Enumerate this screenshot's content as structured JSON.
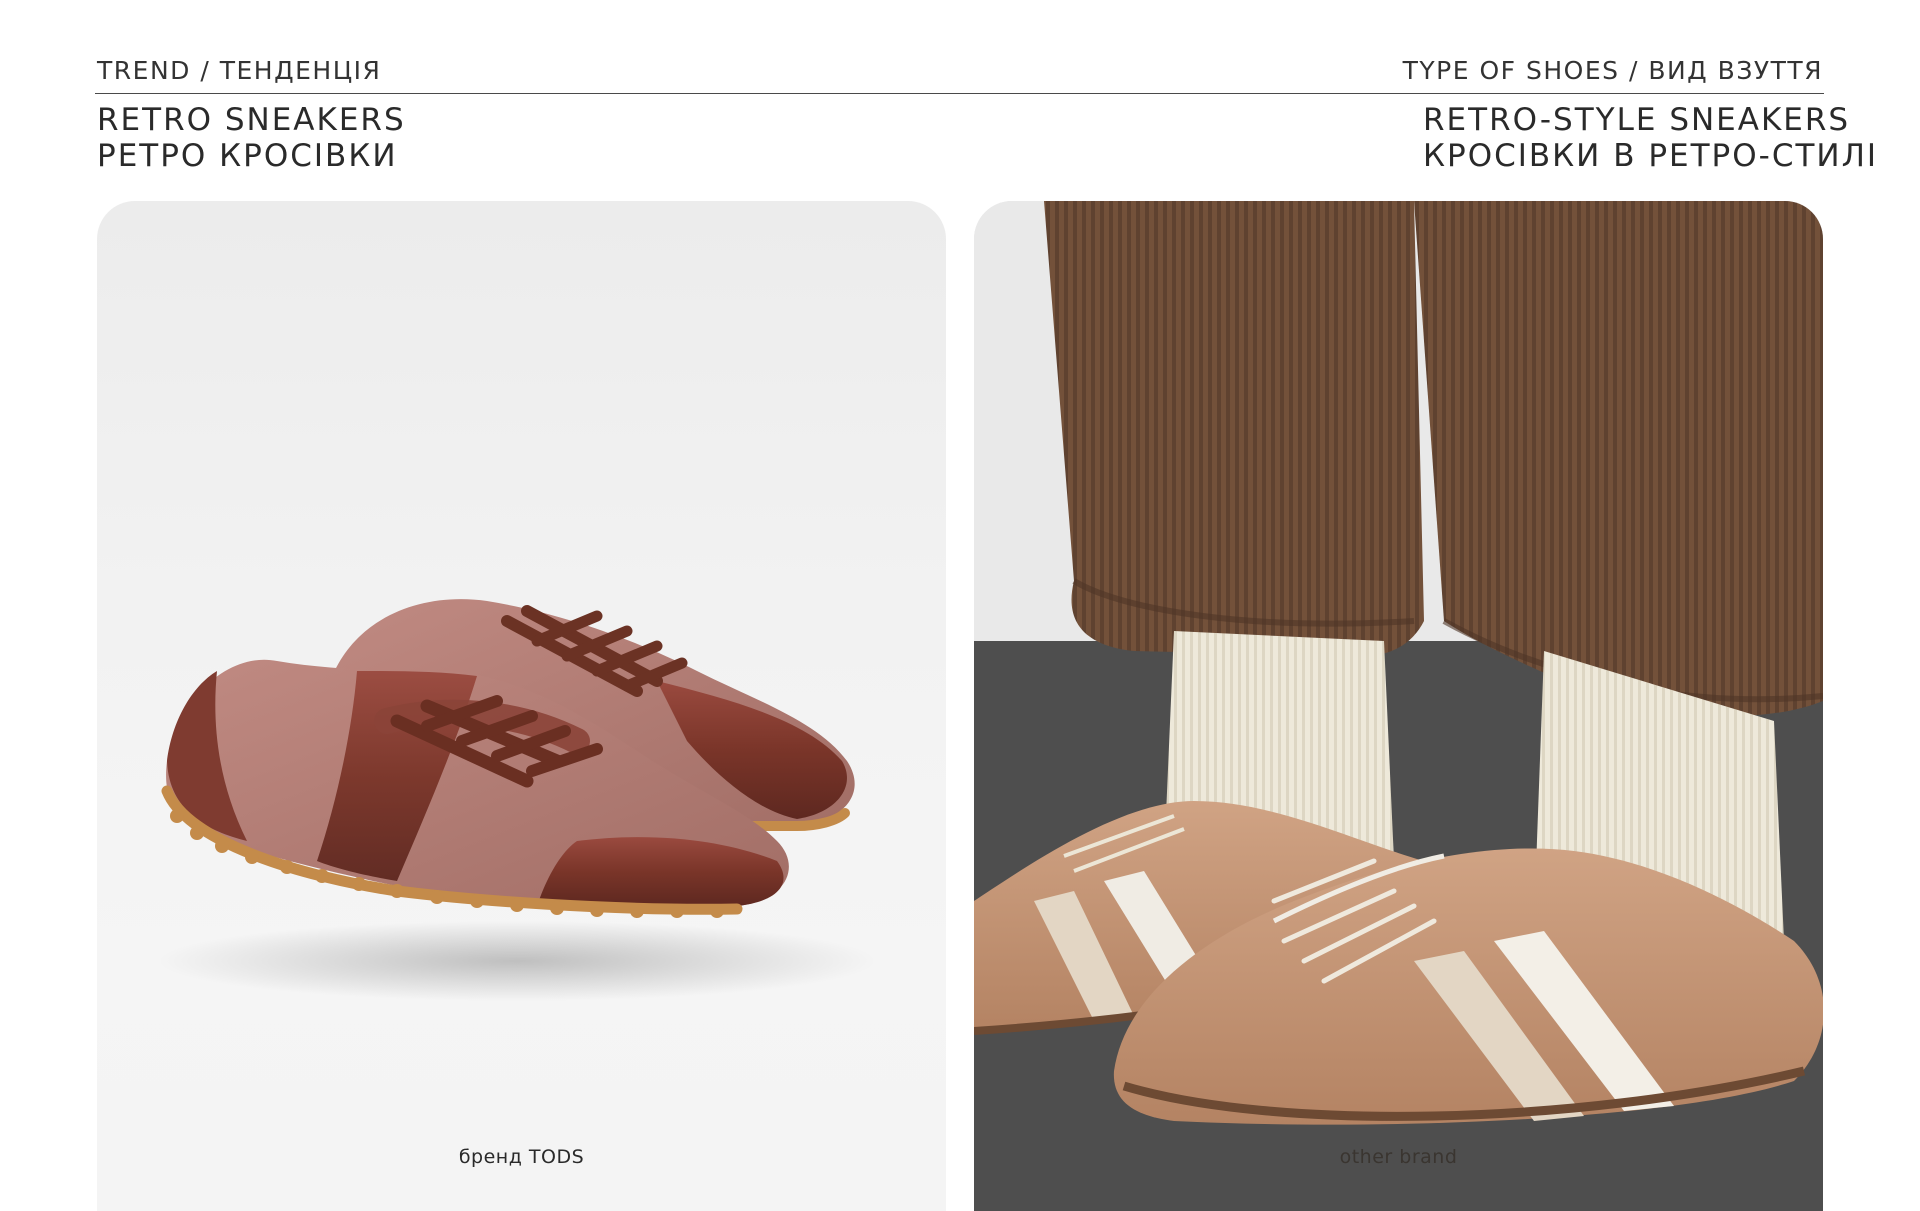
{
  "header": {
    "left_label": "TREND / ТЕНДЕНЦІЯ",
    "right_label": "TYPE OF SHOES / ВИД ВЗУТТЯ",
    "left_title_en": "RETRO SNEAKERS",
    "left_title_uk": "РЕТРО КРОСІВКИ",
    "right_title_en": "RETRO-STYLE SNEAKERS",
    "right_title_uk": "КРОСІВКИ В РЕТРО-СТИЛІ"
  },
  "panels": [
    {
      "caption": "бренд TODS"
    },
    {
      "caption": "other brand"
    }
  ],
  "colors": {
    "suede_pink": "#b47e76",
    "patent_brown": "#7e3a31",
    "gum_sole": "#c48b4a",
    "corduroy": "#6e4d33",
    "sock_cream": "#ece6d6",
    "tan_suede": "#c49777",
    "floor": "#4f4f4f"
  }
}
